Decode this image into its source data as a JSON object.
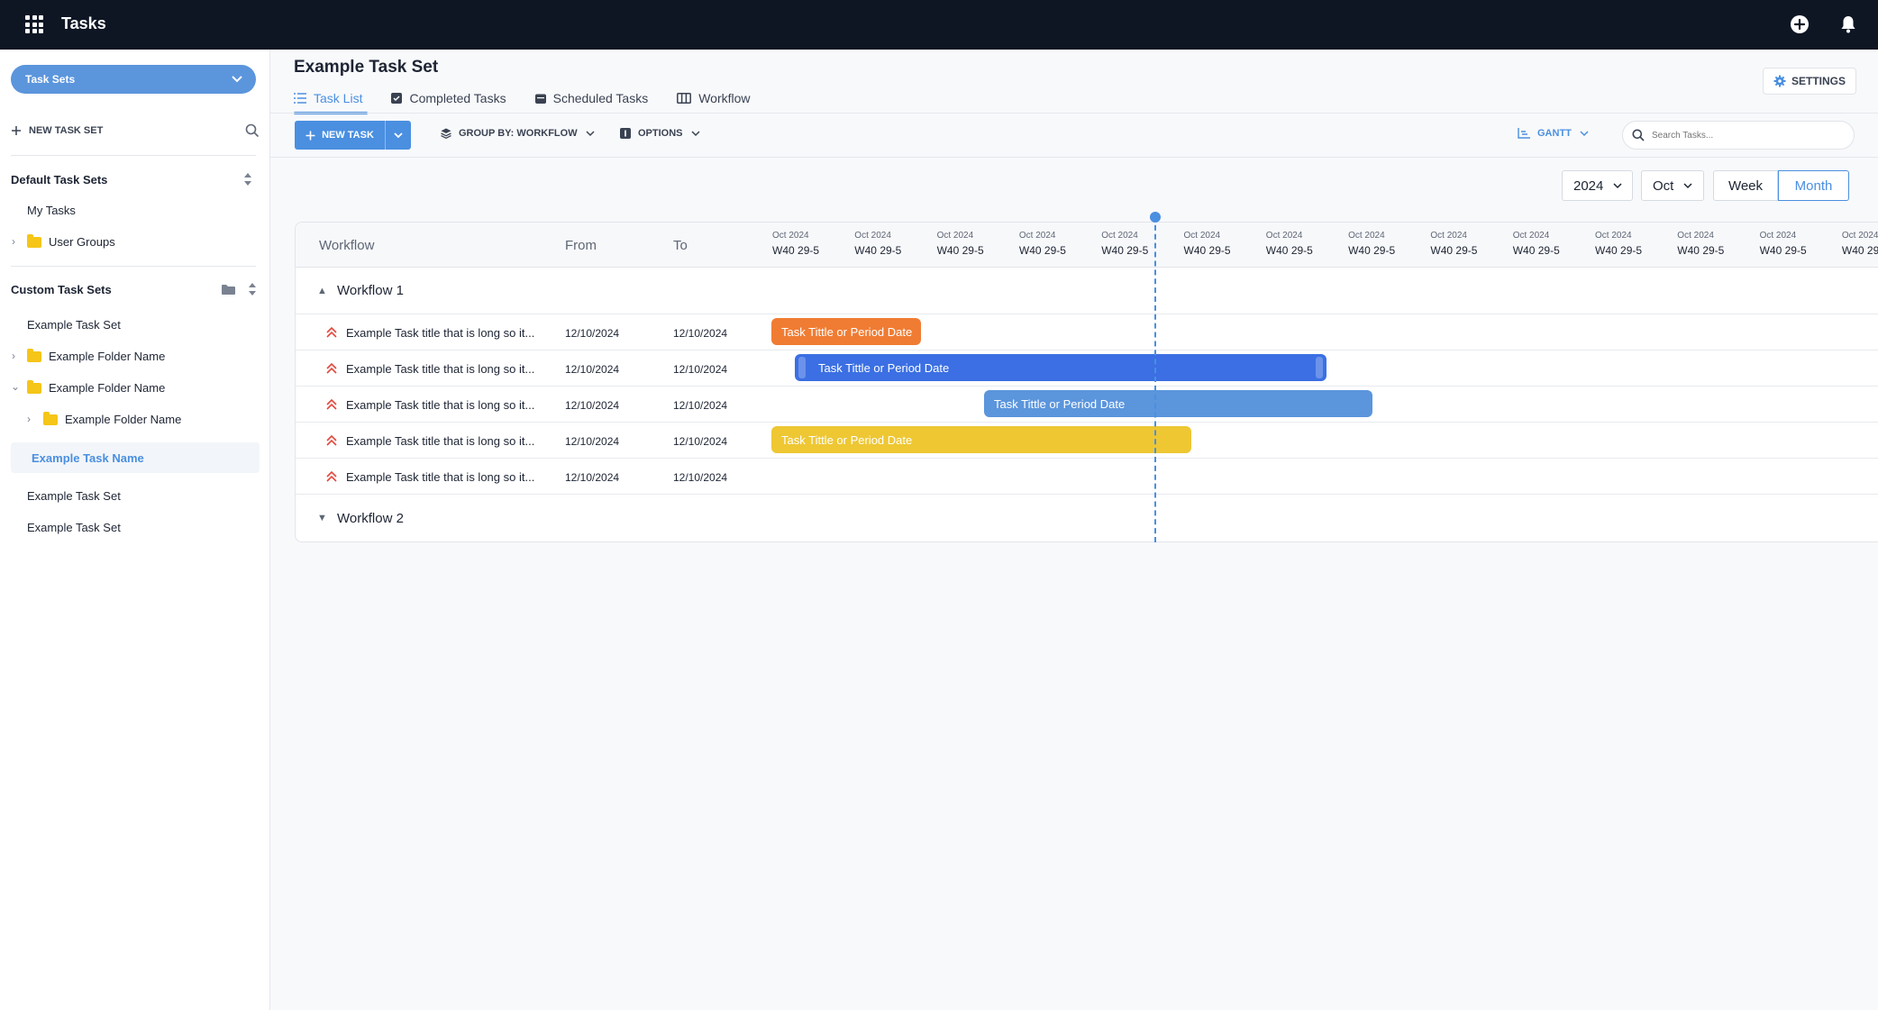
{
  "app": {
    "title": "Tasks"
  },
  "sidebar": {
    "tasksets_button": "Task Sets",
    "new_task_set": "NEW TASK SET",
    "default_heading": "Default Task Sets",
    "default_items": [
      "My Tasks",
      "User Groups"
    ],
    "custom_heading": "Custom Task Sets",
    "custom_items": [
      "Example Task Set",
      "Example Folder Name",
      "Example Folder Name",
      "Example Folder Name",
      "Example Task Name",
      "Example Task Set",
      "Example Task Set"
    ]
  },
  "main": {
    "title": "Example Task Set",
    "tabs": [
      "Task List",
      "Completed Tasks",
      "Scheduled Tasks",
      "Workflow"
    ],
    "settings": "SETTINGS"
  },
  "toolbar": {
    "new_task": "NEW TASK",
    "group_by": "GROUP BY: WORKFLOW",
    "options": "OPTIONS",
    "view": "GANTT",
    "search_placeholder": "Search Tasks..."
  },
  "date_controls": {
    "year": "2024",
    "month": "Oct",
    "segments": [
      "Week",
      "Month"
    ],
    "selected": "Month"
  },
  "grid": {
    "columns": [
      "Workflow",
      "From",
      "To"
    ],
    "timeline_month": "Oct 2024",
    "timeline_weeks": [
      "W40",
      "W40",
      "W40",
      "W40",
      "W40",
      "W40",
      "W40",
      "W40",
      "W40",
      "W40",
      "W40",
      "W40",
      "W40",
      "W40"
    ],
    "timeline_range": "29-5",
    "groups": [
      {
        "name": "Workflow 1",
        "tasks": [
          {
            "name": "Example Task title that is long so it...",
            "from": "12/10/2024",
            "to": "12/10/2024",
            "bar_label": "Task Tittle  or Period Date",
            "color": "#f07c33"
          },
          {
            "name": "Example Task title that is long so it...",
            "from": "12/10/2024",
            "to": "12/10/2024",
            "bar_label": "Task Tittle  or Period Date",
            "color": "#3b6fe3"
          },
          {
            "name": "Example Task title that is long so it...",
            "from": "12/10/2024",
            "to": "12/10/2024",
            "bar_label": "Task Tittle  or Period Date",
            "color": "#5b95dc"
          },
          {
            "name": "Example Task title that is long so it...",
            "from": "12/10/2024",
            "to": "12/10/2024",
            "bar_label": "Task Tittle  or Period Date",
            "color": "#eec733"
          },
          {
            "name": "Example Task title that is long so it...",
            "from": "12/10/2024",
            "to": "12/10/2024",
            "bar_label": "",
            "color": ""
          }
        ]
      },
      {
        "name": "Workflow 2",
        "tasks": []
      }
    ]
  }
}
